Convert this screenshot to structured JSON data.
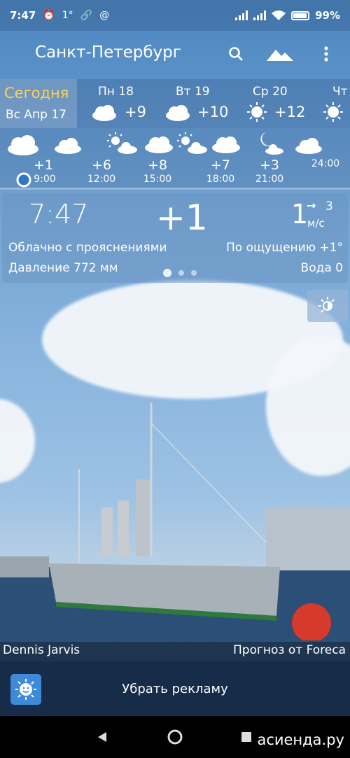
{
  "status_bar": {
    "time": "7:47",
    "temp_indicator": "1°",
    "battery": "99%"
  },
  "app_bar": {
    "city": "Санкт-Петербург",
    "icons": [
      "search-icon",
      "landscape-icon",
      "more-vert-icon"
    ]
  },
  "days": {
    "today": {
      "label": "Сегодня",
      "date": "Вс Апр 17"
    },
    "items": [
      {
        "name": "Пн 18",
        "temp": "+9",
        "icon": "cloud-icon"
      },
      {
        "name": "Вт 19",
        "temp": "+10",
        "icon": "cloud-icon"
      },
      {
        "name": "Ср 20",
        "temp": "+12",
        "icon": "sun-icon"
      },
      {
        "name": "Чт",
        "temp": "",
        "icon": "sun-icon"
      }
    ]
  },
  "hourly": {
    "icons": [
      "cloud-icon",
      "cloud-icon",
      "sun-cloud-icon",
      "cloud-icon",
      "sun-cloud-icon",
      "cloud-icon",
      "moon-cloud-icon",
      "cloud-icon"
    ],
    "items": [
      {
        "temp": "+1",
        "time": "9:00"
      },
      {
        "temp": "+6",
        "time": "12:00"
      },
      {
        "temp": "+8",
        "time": "15:00"
      },
      {
        "temp": "+7",
        "time": "18:00"
      },
      {
        "temp": "+3",
        "time": "21:00"
      },
      {
        "temp": "",
        "time": "24:00"
      }
    ]
  },
  "current": {
    "time": "7:47",
    "temp": "+1",
    "wind_speed": "1",
    "wind_gust": "3",
    "wind_unit": "м/с",
    "wind_arrow": "→",
    "condition": "Облачно с прояснениями",
    "feels_like": "По ощущению +1°",
    "pressure": "Давление 772 мм",
    "water": "Вода 0"
  },
  "photo": {
    "author": "Dennis Jarvis",
    "provider": "Прогноз от Foreca"
  },
  "ad": {
    "label": "Убрать рекламу"
  },
  "watermark": "асиенда.ру"
}
